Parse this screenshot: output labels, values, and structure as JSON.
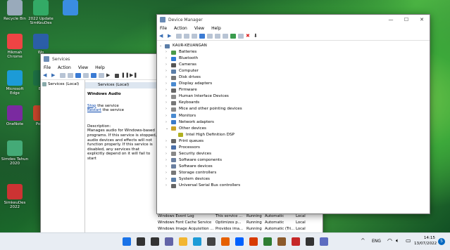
{
  "desktop_icons": [
    {
      "label": "Recycle Bin",
      "color": "#9ab"
    },
    {
      "label": "2022 Update SimKeuDes",
      "color": "#3a6"
    },
    {
      "label": "",
      "color": "#3a8de0"
    },
    {
      "label": "Hikmah Chrome",
      "color": "#e44"
    },
    {
      "label": "Wo",
      "color": "#2b5ea7"
    },
    {
      "label": "Microsoft Edge",
      "color": "#1c9bd7"
    },
    {
      "label": "Ex",
      "color": "#1d7044"
    },
    {
      "label": "OneNote",
      "color": "#7a2aa0"
    },
    {
      "label": "Powe",
      "color": "#c8442b"
    },
    {
      "label": "Simdes Tahun 2020",
      "color": "#4a7"
    },
    {
      "label": "SimkeuDes 2022",
      "color": "#c33"
    }
  ],
  "services": {
    "title": "Services",
    "menu": [
      "File",
      "Action",
      "View",
      "Help"
    ],
    "left_node": "Services (Local)",
    "header": "Services (Local)",
    "selected_name": "Windows Audio",
    "stop_link": "Stop",
    "stop_suffix": " the service",
    "restart_link": "Restart",
    "restart_suffix": " the service",
    "desc_label": "Description:",
    "desc_text": "Manages audio for Windows-based programs.  If this service is stopped, audio devices and effects will not function properly.  If this service is disabled, any services that explicitly depend on it will fail to start",
    "rows": [
      {
        "name": "Windows Event Log",
        "desc": "This service ...",
        "status": "Running",
        "startup": "Automatic",
        "logon": "Local"
      },
      {
        "name": "Windows Font Cache Service",
        "desc": "Optimizes p...",
        "status": "Running",
        "startup": "Automatic",
        "logon": "Local"
      },
      {
        "name": "Windows Image Acquisition ...",
        "desc": "Provides ima...",
        "status": "Running",
        "startup": "Automatic (Tri...",
        "logon": "Local"
      }
    ]
  },
  "device_manager": {
    "title": "Device Manager",
    "menu": [
      "File",
      "Action",
      "View",
      "Help"
    ],
    "root": "KAUR-KEUANGAN",
    "items": [
      {
        "label": "Batteries",
        "expanded": false,
        "child": false
      },
      {
        "label": "Bluetooth",
        "expanded": false,
        "child": false
      },
      {
        "label": "Cameras",
        "expanded": false,
        "child": false
      },
      {
        "label": "Computer",
        "expanded": false,
        "child": false
      },
      {
        "label": "Disk drives",
        "expanded": false,
        "child": false
      },
      {
        "label": "Display adapters",
        "expanded": false,
        "child": false
      },
      {
        "label": "Firmware",
        "expanded": false,
        "child": false
      },
      {
        "label": "Human Interface Devices",
        "expanded": false,
        "child": false
      },
      {
        "label": "Keyboards",
        "expanded": false,
        "child": false
      },
      {
        "label": "Mice and other pointing devices",
        "expanded": false,
        "child": false
      },
      {
        "label": "Monitors",
        "expanded": false,
        "child": false
      },
      {
        "label": "Network adapters",
        "expanded": false,
        "child": false
      },
      {
        "label": "Other devices",
        "expanded": true,
        "child": false
      },
      {
        "label": "Intel High Definition DSP",
        "expanded": false,
        "child": true
      },
      {
        "label": "Print queues",
        "expanded": false,
        "child": false
      },
      {
        "label": "Processors",
        "expanded": false,
        "child": false
      },
      {
        "label": "Security devices",
        "expanded": false,
        "child": false
      },
      {
        "label": "Software components",
        "expanded": false,
        "child": false
      },
      {
        "label": "Software devices",
        "expanded": false,
        "child": false
      },
      {
        "label": "Storage controllers",
        "expanded": false,
        "child": false
      },
      {
        "label": "System devices",
        "expanded": false,
        "child": false
      },
      {
        "label": "Universal Serial Bus controllers",
        "expanded": false,
        "child": false
      }
    ]
  },
  "taskbar": {
    "lang": "ENG",
    "time": "14:15",
    "date": "13/07/2022",
    "notif_count": "5",
    "tray_arrow": "^"
  },
  "accent": "#0067c0"
}
